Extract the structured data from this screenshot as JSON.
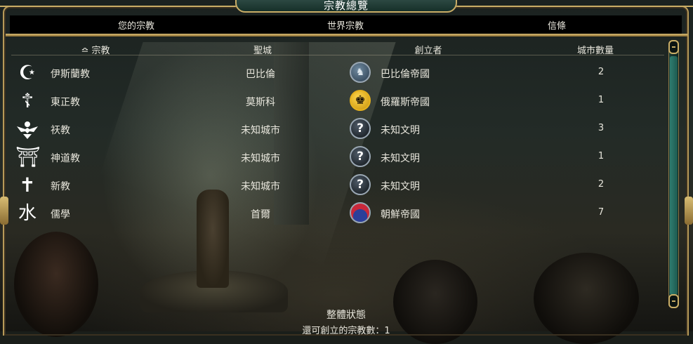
{
  "window": {
    "title": "宗教總覽"
  },
  "tabs": [
    {
      "label": "您的宗教"
    },
    {
      "label": "世界宗教"
    },
    {
      "label": "信條"
    }
  ],
  "columns": {
    "religion": "宗教",
    "sort_indicator": "≏",
    "holy_city": "聖城",
    "founder": "創立者",
    "city_count": "城市數量"
  },
  "rows": [
    {
      "icon": "crescent-star-icon",
      "religion": "伊斯蘭教",
      "holy_city": "巴比倫",
      "founder_icon": "babylon-emblem-icon",
      "founder": "巴比倫帝國",
      "cities": "2"
    },
    {
      "icon": "orthodox-cross-icon",
      "religion": "東正教",
      "holy_city": "莫斯科",
      "founder_icon": "russia-eagle-icon",
      "founder": "俄羅斯帝國",
      "cities": "1"
    },
    {
      "icon": "faravahar-icon",
      "religion": "祆教",
      "holy_city": "未知城市",
      "founder_icon": "unknown-civ-icon",
      "founder": "未知文明",
      "cities": "3"
    },
    {
      "icon": "torii-icon",
      "religion": "神道教",
      "holy_city": "未知城市",
      "founder_icon": "unknown-civ-icon",
      "founder": "未知文明",
      "cities": "1"
    },
    {
      "icon": "latin-cross-icon",
      "religion": "新教",
      "holy_city": "未知城市",
      "founder_icon": "unknown-civ-icon",
      "founder": "未知文明",
      "cities": "2"
    },
    {
      "icon": "water-glyph-icon",
      "religion": "儒學",
      "holy_city": "首爾",
      "founder_icon": "korea-taegeuk-icon",
      "founder": "朝鮮帝國",
      "cities": "7"
    }
  ],
  "status": {
    "title": "整體狀態",
    "remaining_label": "還可創立的宗教數：1"
  },
  "colors": {
    "frame_gold": "#c9ad66",
    "title_teal": "#2f4b45",
    "scroll_teal": "#2f7d70",
    "russia_gold": "#e6b21e",
    "korea_red": "#c8283a"
  }
}
